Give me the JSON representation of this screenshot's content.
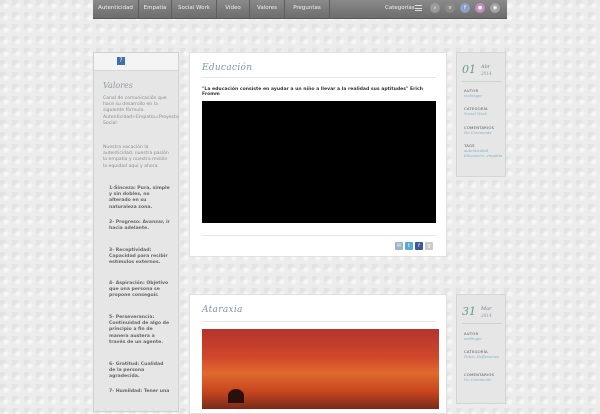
{
  "nav": {
    "items": [
      "Autenticidad",
      "Empatía",
      "Social Work",
      "Vídeo",
      "Valores",
      "Preguntas"
    ],
    "categories_label": "Categorías",
    "social": [
      {
        "icon": "search-icon",
        "glyph": "⌕",
        "color": "#9a9a9a"
      },
      {
        "icon": "vimeo-icon",
        "glyph": "v",
        "color": "#8a8a8a"
      },
      {
        "icon": "facebook-icon",
        "glyph": "f",
        "color": "#8aa1c4"
      },
      {
        "icon": "flickr-icon",
        "glyph": "●",
        "color": "#c48bbd"
      },
      {
        "icon": "rss-icon",
        "glyph": "◉",
        "color": "#a3a3a3"
      }
    ]
  },
  "sidebar": {
    "icon_glyph": "?",
    "title": "Valores",
    "intro": "Canal de comunicación que hace su desarrollo en la siguiente fórmula. Autenticidad+Empatía=Proyecto Social",
    "mission": "Nuestra vocación la autenticidad, nuestra pasión la empatía y nuestra misión la equidad aquí y ahora.",
    "values": [
      "1-Sinceza: Pura, simple y sin dobles, no alterado en su naturaleza zona.",
      "2- Progreso: Avanzar, ir hacia adelante.",
      "3- Receptividad: Capacidad para recibir estímulos externos.",
      "4- Aspiración: Objetivo que una persona se propone conseguir.",
      "5- Perseverancia: Continuidad de algo de principio a fin de manera austera a través de un agente.",
      "6- Gratitud: Cualidad de la persona agradecida.",
      "7- Humildad: Tener una"
    ]
  },
  "posts": [
    {
      "title": "Educación",
      "quote": "\"La educación consiste en ayudar a un niño a llevar a la realidad sus aptitudes\" Erich Fromm",
      "meta": {
        "day": "01",
        "month": "Abr",
        "year": "2014",
        "author_label": "AUTOR",
        "author": "webinger",
        "category_label": "CATEGORÍA",
        "category": "Social Work",
        "comments_label": "COMENTARIOS",
        "comments": "No Comments",
        "tags_label": "TAGS",
        "tags": "autenticidad, Educación, empatía"
      }
    },
    {
      "title": "Ataraxia",
      "meta": {
        "day": "31",
        "month": "Mar",
        "year": "2014",
        "author_label": "AUTOR",
        "author": "webinger",
        "category_label": "CATEGORÍA",
        "category": "Fotos, Reflexiones",
        "comments_label": "COMENTARIOS",
        "comments": "No Comments"
      }
    }
  ],
  "share_icons": [
    {
      "icon": "email-icon",
      "glyph": "✉",
      "color": "#9eb3c4"
    },
    {
      "icon": "twitter-icon",
      "glyph": "t",
      "color": "#59a8d8"
    },
    {
      "icon": "facebook-icon",
      "glyph": "f",
      "color": "#3b5998"
    },
    {
      "icon": "google-plus-icon",
      "glyph": "g",
      "color": "#c9c9c9"
    }
  ]
}
